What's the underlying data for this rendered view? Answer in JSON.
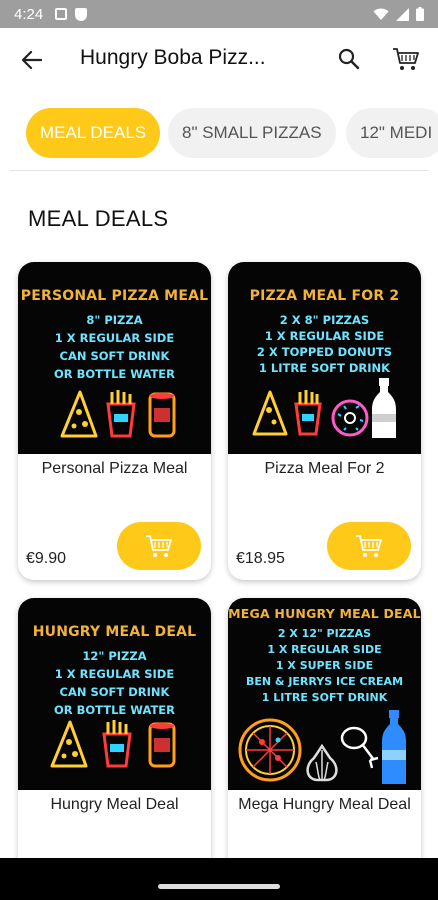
{
  "status_bar": {
    "time": "4:24"
  },
  "header": {
    "title": "Hungry Boba Pizz..."
  },
  "tabs": [
    {
      "label": "MEAL DEALS",
      "active": true
    },
    {
      "label": "8\" SMALL PIZZAS",
      "active": false
    },
    {
      "label": "12\" MEDI",
      "active": false
    }
  ],
  "section": {
    "title": "MEAL DEALS"
  },
  "cards": [
    {
      "name": "Personal Pizza Meal",
      "price": "€9.90",
      "promo": {
        "title": "PERSONAL PIZZA MEAL",
        "lines": [
          "8\" PIZZA",
          "1 X REGULAR SIDE",
          "CAN SOFT DRINK",
          "OR BOTTLE WATER"
        ]
      }
    },
    {
      "name": "Pizza Meal For 2",
      "price": "€18.95",
      "promo": {
        "title": "PIZZA MEAL FOR 2",
        "lines": [
          "2 X 8\" PIZZAS",
          "1 X REGULAR SIDE",
          "2 X TOPPED DONUTS",
          "1 LITRE SOFT DRINK"
        ]
      }
    },
    {
      "name": "Hungry Meal Deal",
      "price": "",
      "promo": {
        "title": "HUNGRY MEAL DEAL",
        "lines": [
          "12\" PIZZA",
          "1 X REGULAR SIDE",
          "CAN SOFT DRINK",
          "OR BOTTLE WATER"
        ]
      }
    },
    {
      "name": "Mega Hungry Meal Deal",
      "price": "",
      "promo": {
        "title": "MEGA HUNGRY MEAL DEAL",
        "lines": [
          "2 X 12\" PIZZAS",
          "1 X REGULAR SIDE",
          "1 X SUPER SIDE",
          "BEN & JERRYS ICE CREAM",
          "1 LITRE SOFT DRINK"
        ]
      }
    }
  ],
  "colors": {
    "accent": "#ffc91a",
    "status_bar": "#9e9e9e",
    "promo_title": "#f2b33a",
    "promo_text": "#6fe3ff"
  },
  "icons": [
    "back-arrow-icon",
    "search-icon",
    "cart-icon",
    "add-to-cart-icon",
    "wifi-icon",
    "signal-icon",
    "battery-icon"
  ]
}
